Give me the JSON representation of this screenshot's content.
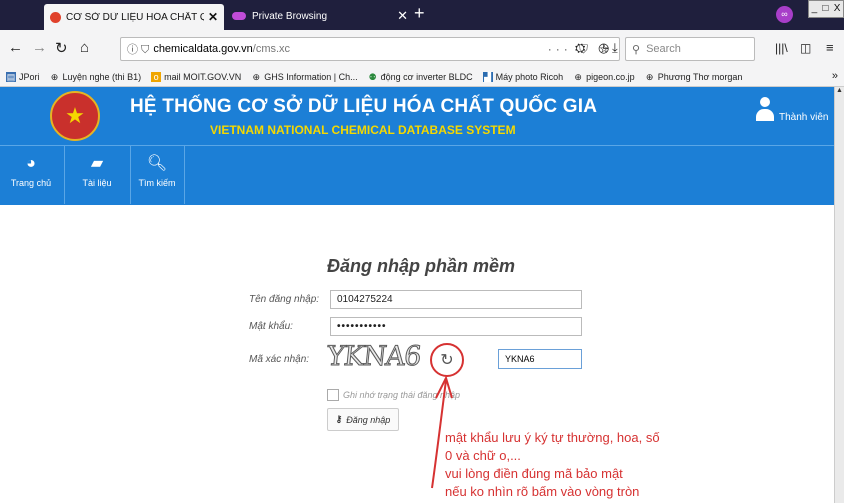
{
  "browser": {
    "active_tab": {
      "title": "CƠ SỞ DỮ LIỆU HÓA CHẤT QUỐC",
      "close": "✕"
    },
    "private_tab": {
      "title": "Private Browsing",
      "close": "✕"
    },
    "new_tab": "+",
    "window_buttons": [
      "_",
      "□",
      "X"
    ],
    "url": {
      "domain": "chemicaldata.gov.vn",
      "path": "/cms.xc",
      "actions": "··· ⛉ ☆"
    },
    "search_placeholder": "Search",
    "bookmarks": [
      "JPori",
      "Luyện nghe (thi B1)",
      "mail MOIT.GOV.VN",
      "GHS Information | Ch...",
      "động cơ inverter BLDC",
      "Máy photo Ricoh",
      "pigeon.co.jp",
      "Phương Thơ morgan"
    ],
    "bookmarks_more": "»"
  },
  "site": {
    "title": "HỆ THỐNG CƠ SỞ DỮ LIỆU HÓA CHẤT QUỐC GIA",
    "subtitle": "VIETNAM NATIONAL CHEMICAL DATABASE SYSTEM",
    "member_label": "Thành viên",
    "nav": [
      {
        "label": "Trang chủ",
        "icon": "dashboard-icon"
      },
      {
        "label": "Tài liệu",
        "icon": "book-icon"
      },
      {
        "label": "Tìm kiếm",
        "icon": "search-icon"
      }
    ]
  },
  "login": {
    "title": "Đăng nhập phần mềm",
    "username_label": "Tên đăng nhập:",
    "username_value": "0104275224",
    "password_label": "Mật khẩu:",
    "password_value": "•••••••••••",
    "captcha_label": "Mã xác nhận:",
    "captcha_image_text": "YKNA6",
    "captcha_value": "YKNA6",
    "remember_label": "Ghi nhớ trạng thái đăng nhập",
    "login_button": "Đăng nhập"
  },
  "annotation": {
    "lines": [
      "mật khẩu lưu ý ký tự thường, hoa, số",
      "0 và chữ o,...",
      "vui lòng điền đúng mã bảo mật",
      "nếu ko nhìn rõ bấm vào vòng tròn"
    ],
    "color": "#d63232"
  },
  "colors": {
    "header_blue": "#1c7fd6",
    "subtitle_yellow": "#f5d800",
    "tabstrip": "#1f1f3d"
  }
}
